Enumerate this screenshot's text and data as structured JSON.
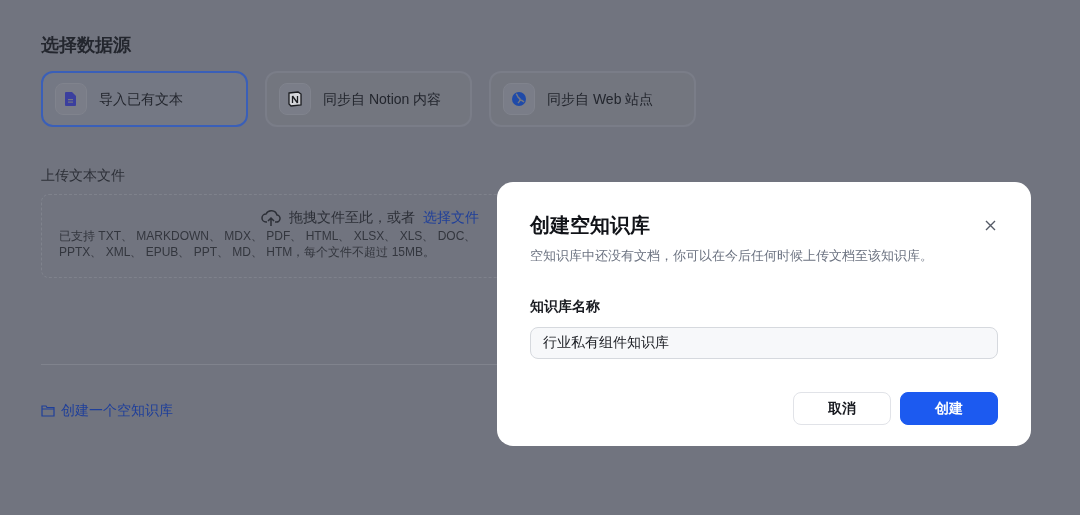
{
  "page": {
    "title": "选择数据源",
    "sources": [
      {
        "kind": "file",
        "label": "导入已有文本",
        "selected": true
      },
      {
        "kind": "notion",
        "label": "同步自 Notion 内容",
        "selected": false
      },
      {
        "kind": "web",
        "label": "同步自 Web 站点",
        "selected": false
      }
    ],
    "upload": {
      "label": "上传文本文件",
      "prompt": "拖拽文件至此，或者",
      "link": "选择文件",
      "hint_lines": [
        "已支持 TXT、 MARKDOWN、 MDX、 PDF、 HTML、 XLSX、 XLS、 DOC、",
        "PPTX、 XML、 EPUB、 PPT、 MD、 HTM，每个文件不超过 15MB。"
      ]
    },
    "create_empty_link": "创建一个空知识库"
  },
  "dialog": {
    "title": "创建空知识库",
    "description": "空知识库中还没有文档，你可以在今后任何时候上传文档至该知识库。",
    "field_label": "知识库名称",
    "field_value": "行业私有组件知识库",
    "buttons": [
      {
        "kind": "secondary",
        "label": "取消"
      },
      {
        "kind": "primary",
        "label": "创建"
      }
    ]
  }
}
